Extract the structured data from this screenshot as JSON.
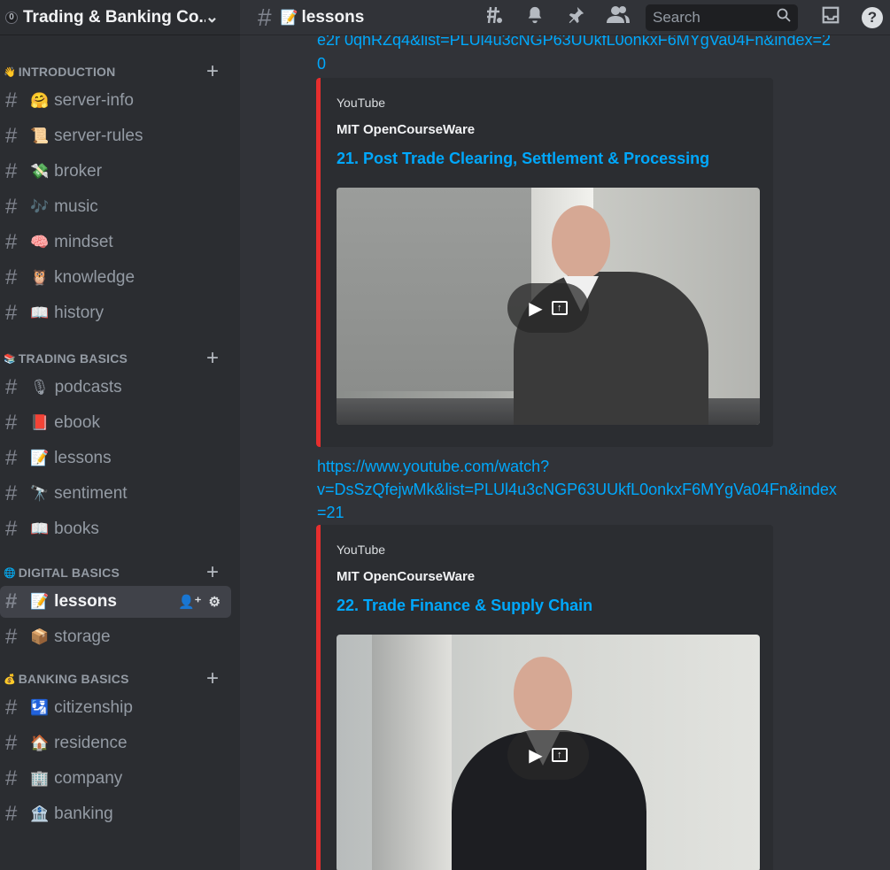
{
  "server": {
    "badge": "0",
    "name": "Trading & Banking Co...",
    "chevron": "⌄"
  },
  "categories": [
    {
      "emoji": "👋",
      "name": "INTRODUCTION",
      "channels": [
        {
          "emoji": "🤗",
          "name": "server-info"
        },
        {
          "emoji": "📜",
          "name": "server-rules"
        },
        {
          "emoji": "💸",
          "name": "broker"
        },
        {
          "emoji": "🎶",
          "name": "music"
        },
        {
          "emoji": "🧠",
          "name": "mindset"
        },
        {
          "emoji": "🦉",
          "name": "knowledge"
        },
        {
          "emoji": "📖",
          "name": "history"
        }
      ]
    },
    {
      "emoji": "📚",
      "name": "TRADING BASICS",
      "channels": [
        {
          "emoji": "🎙",
          "name": "podcasts"
        },
        {
          "emoji": "📕",
          "name": "ebook"
        },
        {
          "emoji": "📝",
          "name": "lessons"
        },
        {
          "emoji": "🔭",
          "name": "sentiment"
        },
        {
          "emoji": "📖",
          "name": "books"
        }
      ]
    },
    {
      "emoji": "🌐",
      "name": "DIGITAL BASICS",
      "channels": [
        {
          "emoji": "📝",
          "name": "lessons",
          "active": true
        },
        {
          "emoji": "📦",
          "name": "storage"
        }
      ]
    },
    {
      "emoji": "💰",
      "name": "BANKING BASICS",
      "channels": [
        {
          "emoji": "🛂",
          "name": "citizenship"
        },
        {
          "emoji": "🏠",
          "name": "residence"
        },
        {
          "emoji": "🏢",
          "name": "company"
        },
        {
          "emoji": "🏦",
          "name": "banking"
        }
      ]
    }
  ],
  "topbar": {
    "channel_emoji": "📝",
    "channel_name": "lessons",
    "search_placeholder": "Search"
  },
  "messages": {
    "top_link_partial": "e2r 0qhRZq4&list=PLUl4u3cNGP63UUkfL0onkxF6MYgVa04Fn&index=2",
    "top_link_end": "0",
    "embeds": [
      {
        "provider": "YouTube",
        "author": "MIT OpenCourseWare",
        "title": "21. Post Trade Clearing, Settlement & Processing"
      },
      {
        "provider": "YouTube",
        "author": "MIT OpenCourseWare",
        "title": "22. Trade Finance & Supply Chain"
      }
    ],
    "link2_line1": "https://www.youtube.com/watch?",
    "link2_line2": "v=DsSzQfejwMk&list=PLUl4u3cNGP63UUkfL0onkxF6MYgVa04Fn&index",
    "link2_line3": "=21"
  },
  "colors": {
    "accent_link": "#00a8fc",
    "embed_border": "#e62e2e"
  }
}
